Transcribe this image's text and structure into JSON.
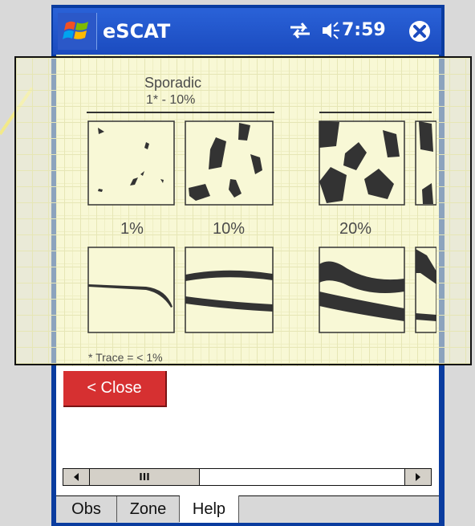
{
  "title_bar": {
    "app_title": "eSCAT",
    "time": "7:59",
    "icons": [
      "windows-start-icon",
      "sync-icon",
      "volume-icon",
      "close-circle-icon"
    ]
  },
  "diagram": {
    "heading": "Sporadic",
    "subheading": "1* - 10%",
    "percent_labels": [
      "1%",
      "10%",
      "20%"
    ],
    "footnote": "* Trace = < 1%"
  },
  "close_button": {
    "label": "< Close"
  },
  "scrollbar": {
    "thumb_label": "III"
  },
  "tabs": [
    {
      "label": "Obs"
    },
    {
      "label": "Zone"
    },
    {
      "label": "Help",
      "selected": true
    }
  ],
  "colors": {
    "title_bar": "#1b4bbf",
    "close_button": "#d63031",
    "content_background": "#f8f8d6"
  }
}
